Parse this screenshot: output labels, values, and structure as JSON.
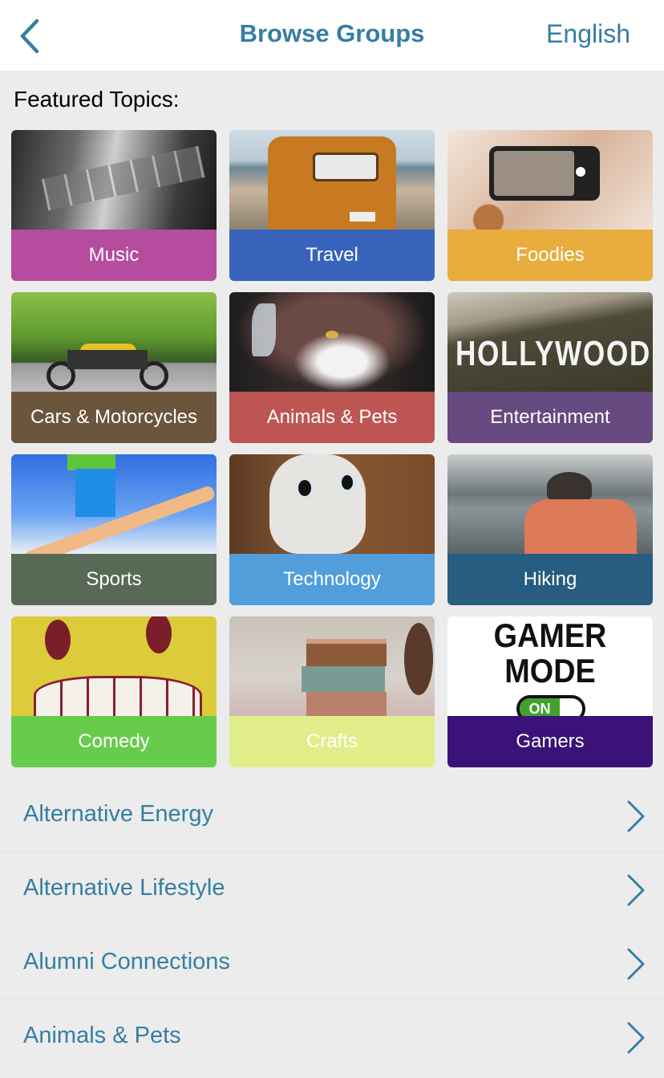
{
  "header": {
    "back_icon": "chevron-left-icon",
    "title": "Browse Groups",
    "language": "English"
  },
  "featured": {
    "title": "Featured Topics:",
    "tiles": [
      {
        "label": "Music",
        "color": "#b64c9e",
        "image": "guitar-photo"
      },
      {
        "label": "Travel",
        "color": "#3763bb",
        "image": "van-photo"
      },
      {
        "label": "Foodies",
        "color": "#e8ad3d",
        "image": "phone-food-photo"
      },
      {
        "label": "Cars & Motorcycles",
        "color": "#6b553c",
        "image": "motorcycle-photo"
      },
      {
        "label": "Animals & Pets",
        "color": "#bd5652",
        "image": "cat-photo"
      },
      {
        "label": "Entertainment",
        "color": "#674a80",
        "image": "hollywood-photo"
      },
      {
        "label": "Sports",
        "color": "#586a56",
        "image": "skier-photo"
      },
      {
        "label": "Technology",
        "color": "#519edb",
        "image": "robot-photo"
      },
      {
        "label": "Hiking",
        "color": "#265d80",
        "image": "hiker-photo"
      },
      {
        "label": "Comedy",
        "color": "#67cc4c",
        "image": "emoji-balloon-photo"
      },
      {
        "label": "Crafts",
        "color": "#e1ee8a",
        "image": "crafts-photo"
      },
      {
        "label": "Gamers",
        "color": "#3a1278",
        "image": "gamer-mode-graphic",
        "image_text": [
          "GAMER",
          "MODE",
          "ON"
        ]
      }
    ]
  },
  "categories": [
    {
      "label": "Alternative Energy"
    },
    {
      "label": "Alternative Lifestyle"
    },
    {
      "label": "Alumni Connections"
    },
    {
      "label": "Animals & Pets"
    }
  ],
  "colors": {
    "accent": "#367ea3",
    "background": "#ececec",
    "navbar": "#ffffff"
  }
}
